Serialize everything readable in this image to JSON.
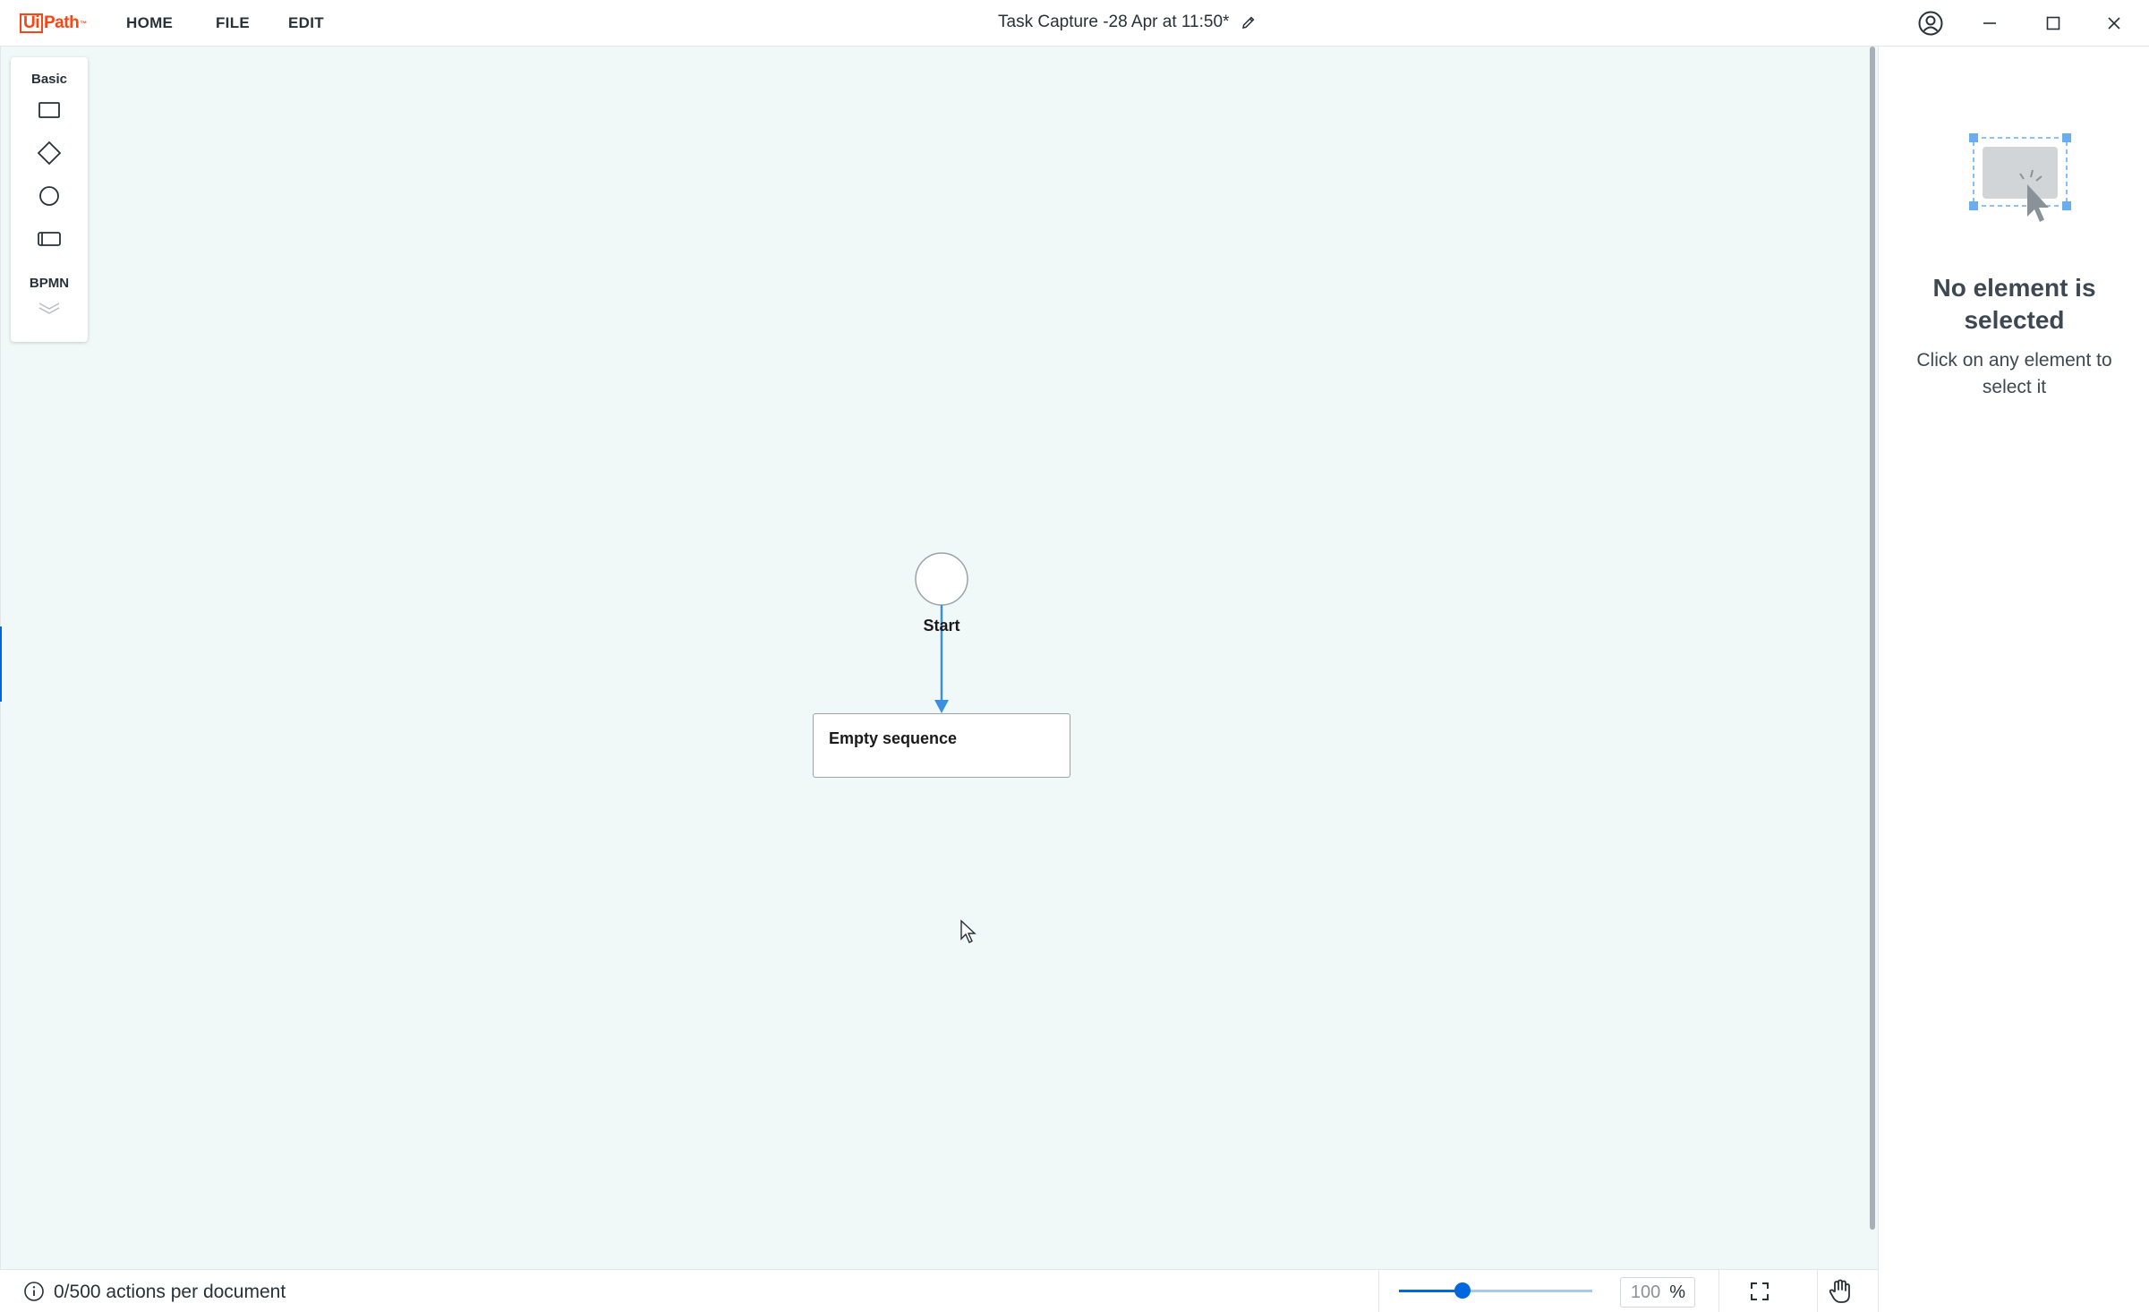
{
  "app": {
    "logo_text": "UiPath",
    "menu": [
      "HOME",
      "FILE",
      "EDIT"
    ],
    "document_title": "Task Capture -28 Apr at 11:50*"
  },
  "palette": {
    "basic_label": "Basic",
    "bpmn_label": "BPMN",
    "tools": [
      "rectangle-icon",
      "diamond-icon",
      "circle-icon",
      "rounded-rectangle-icon"
    ]
  },
  "diagram": {
    "start_label": "Start",
    "sequence_label": "Empty sequence"
  },
  "panel": {
    "title": "No element is selected",
    "subtitle": "Click on any element to select it"
  },
  "statusbar": {
    "actions_text": "0/500 actions per document",
    "zoom_value": "100",
    "zoom_unit": "%",
    "zoom_fraction": 0.33
  },
  "colors": {
    "brand": "#fa4616",
    "accent": "#0067df",
    "canvas_bg": "#f1f9f8",
    "connector": "#3b8fe0"
  }
}
